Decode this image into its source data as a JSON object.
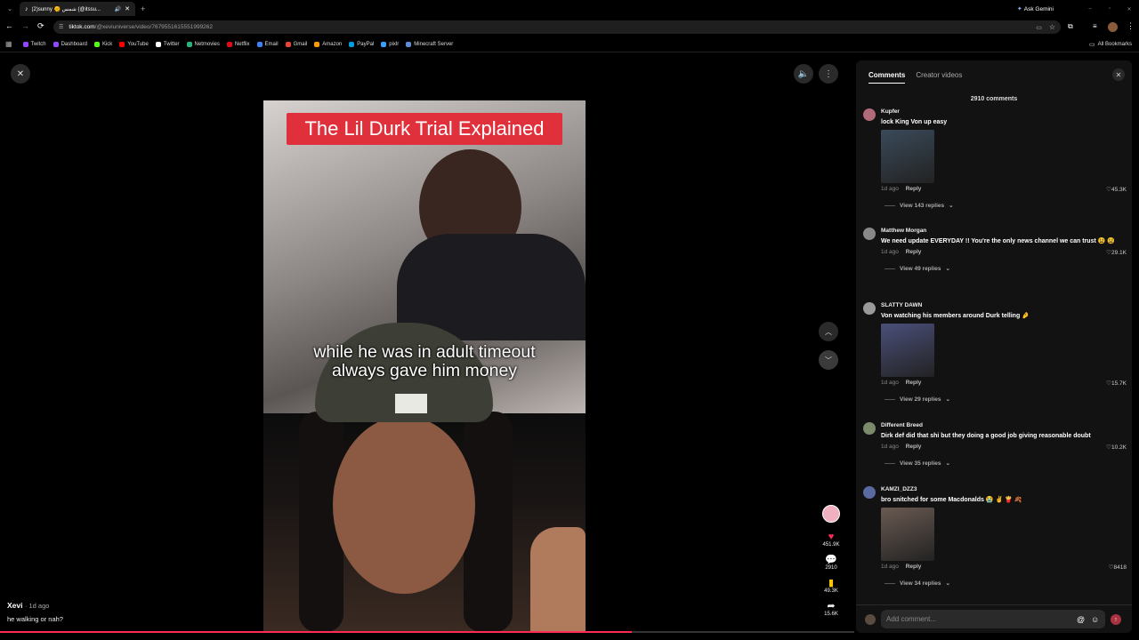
{
  "browser": {
    "tab_title": "(2)sunny 🌞 شمس (@itssu...",
    "url_host": "tiktok.com",
    "url_path": "/@xeviuniverse/video/7679551615551999262",
    "ask_gemini": "Ask Gemini",
    "all_bookmarks": "All Bookmarks",
    "bookmarks": [
      {
        "label": "Twitch",
        "color": "#9146ff"
      },
      {
        "label": "Dashboard",
        "color": "#9146ff"
      },
      {
        "label": "Kick",
        "color": "#53fc18"
      },
      {
        "label": "YouTube",
        "color": "#ff0000"
      },
      {
        "label": "Twitter",
        "color": "#ffffff"
      },
      {
        "label": "Netmovies",
        "color": "#2ab27b"
      },
      {
        "label": "Netflix",
        "color": "#e50914"
      },
      {
        "label": "Email",
        "color": "#3b82f6"
      },
      {
        "label": "Gmail",
        "color": "#ea4335"
      },
      {
        "label": "Amazon",
        "color": "#ff9900"
      },
      {
        "label": "PayPal",
        "color": "#009cde"
      },
      {
        "label": "pixlr",
        "color": "#3aa0ff"
      },
      {
        "label": "Minecraft Server",
        "color": "#5b8dd6"
      }
    ]
  },
  "video": {
    "title_overlay": "The Lil Durk Trial Explained",
    "caption_line1": "while he was in adult timeout",
    "caption_line2": "always gave him money",
    "author": "Xevi",
    "age": "1d ago",
    "description": "he walking or nah?",
    "progress_fraction": 0.74,
    "likes": "451.9K",
    "comments": "2910",
    "saves": "49.3K",
    "shares": "15.6K"
  },
  "panel": {
    "tab_comments": "Comments",
    "tab_creator": "Creator videos",
    "count": "2910 comments",
    "add_placeholder": "Add comment...",
    "comments": [
      {
        "user": "Kupfer",
        "text": "lock King Von up easy",
        "age": "1d ago",
        "reply": "Reply",
        "likes": "45.3K",
        "view": "View 143 replies",
        "thumb": "#3a4a5a"
      },
      {
        "user": "Matthew Morgan",
        "text": "We need update EVERYDAY !! You're the only news channel we can trust 😫 😫",
        "age": "1d ago",
        "reply": "Reply",
        "likes": "29.1K",
        "view": "View 49 replies"
      },
      {
        "user": "SLATTY DAWN",
        "text": "Von watching his members around Durk telling 🤌",
        "age": "1d ago",
        "reply": "Reply",
        "likes": "15.7K",
        "view": "View 29 replies",
        "thumb": "#4a4f7a"
      },
      {
        "user": "Different Breed",
        "text": "Dirk def did that shi but they doing a good job giving reasonable doubt",
        "age": "1d ago",
        "reply": "Reply",
        "likes": "10.2K",
        "view": "View 35 replies"
      },
      {
        "user": "KAMZI_DZZ3",
        "text": "bro snitched for some Macdonalds 😭 ✌️ 🍟 🍂",
        "age": "1d ago",
        "reply": "Reply",
        "likes": "8418",
        "view": "View 34 replies",
        "thumb": "#6a5a52"
      }
    ]
  }
}
